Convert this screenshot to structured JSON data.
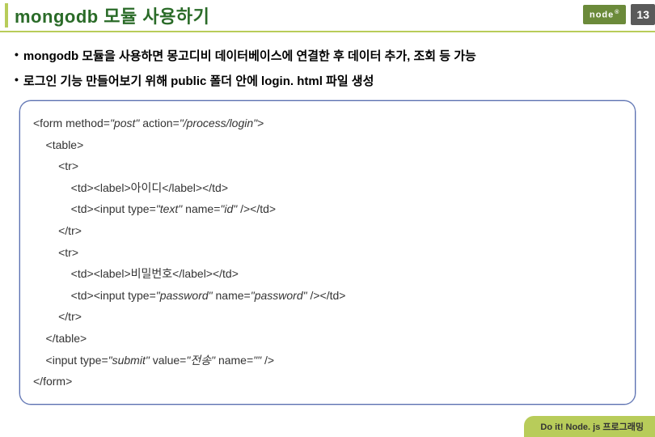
{
  "header": {
    "title": "mongodb 모듈 사용하기",
    "logo": "node",
    "page_number": "13"
  },
  "bullets": [
    "mongodb 모듈을 사용하면 몽고디비 데이터베이스에 연결한 후 데이터 추가, 조회 등 가능",
    "로그인 기능 만들어보기 위해 public 폴더 안에 login. html 파일 생성"
  ],
  "code": {
    "line1_a": "<form method=",
    "line1_b": "\"post\"",
    "line1_c": " action=",
    "line1_d": "\"/process/login\"",
    "line1_e": ">",
    "line2": "    <table>",
    "line3": "        <tr>",
    "line4": "            <td><label>아이디</label></td>",
    "line5_a": "            <td><input type=",
    "line5_b": "\"text\"",
    "line5_c": " name=",
    "line5_d": "\"id\"",
    "line5_e": " /></td>",
    "line6": "        </tr>",
    "line7": "        <tr>",
    "line8": "            <td><label>비밀번호</label></td>",
    "line9_a": "            <td><input type=",
    "line9_b": "\"password\"",
    "line9_c": " name=",
    "line9_d": "\"password\"",
    "line9_e": " /></td>",
    "line10": "        </tr>",
    "line11": "    </table>",
    "line12_a": "    <input type=",
    "line12_b": "\"submit\"",
    "line12_c": " value=",
    "line12_d": "\"전송\"",
    "line12_e": " name=",
    "line12_f": "\"\"",
    "line12_g": " />",
    "line13": "</form>"
  },
  "footer": {
    "label": "Do it! Node. js 프로그래밍"
  }
}
